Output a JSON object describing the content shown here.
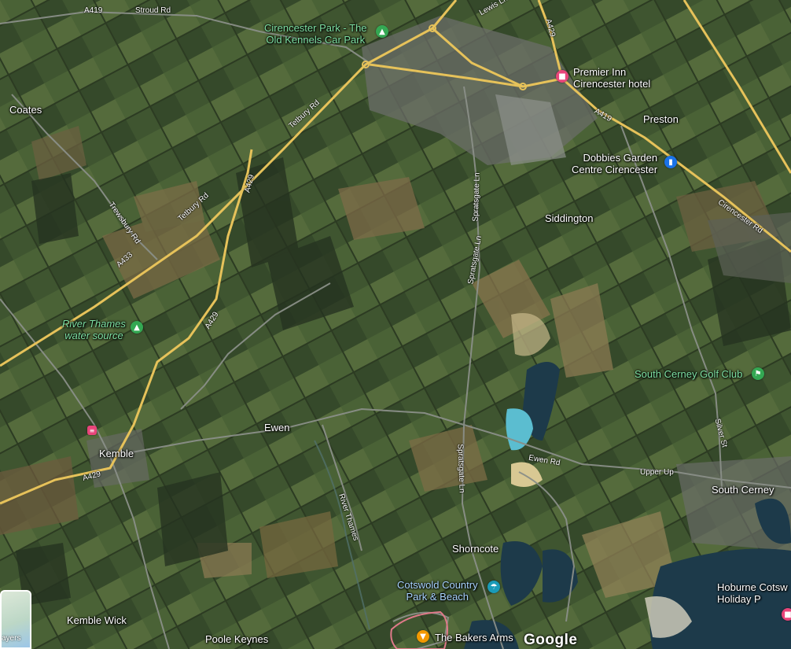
{
  "map": {
    "type": "satellite",
    "branding": "Google",
    "layers_label": "ayers"
  },
  "places": {
    "coates": "Coates",
    "siddington": "Siddington",
    "preston": "Preston",
    "ewen": "Ewen",
    "kemble": "Kemble",
    "south_cerney": "South Cerney",
    "shorncote": "Shorncote",
    "kemble_wick": "Kemble Wick",
    "poole_keynes": "Poole Keynes"
  },
  "pois": {
    "cirencester_park": "Cirencester Park - The Old Kennels Car Park",
    "cirencester_park_line1": "Cirencester Park - The",
    "cirencester_park_line2": "Old Kennels Car Park",
    "premier_inn_line1": "Premier Inn",
    "premier_inn_line2": "Cirencester hotel",
    "dobbies_line1": "Dobbies Garden",
    "dobbies_line2": "Centre Cirencester",
    "river_thames_source_line1": "River Thames",
    "river_thames_source_line2": "water source",
    "golf_club": "South Cerney Golf Club",
    "cotswold_park_line1": "Cotswold Country",
    "cotswold_park_line2": "Park & Beach",
    "hoburne_line1": "Hoburne Cotsw",
    "hoburne_line2": "Holiday P",
    "bakers_arms": "The Bakers Arms"
  },
  "roads": {
    "a419_top": "A419",
    "stroud_rd": "Stroud Rd",
    "lewis_ln": "Lewis Ln",
    "a429_top": "A429",
    "tetbury_rd_1": "Tetbury Rd",
    "tetbury_rd_2": "Tetbury Rd",
    "a429_mid": "A429",
    "trewsbury_rd": "Trewsbury Rd",
    "a433": "A433",
    "a429_low": "A429",
    "a429_kemble": "A429",
    "a419_right": "A419",
    "cirencester_rd": "Cirencester Rd",
    "spratsgate_ln_1": "Spratsgate Ln",
    "spratsgate_ln_2": "Spratsgate Ln",
    "river_thames": "River Thames",
    "ewen_rd": "Ewen Rd",
    "upper_up": "Upper Up",
    "silver_st": "Silver St"
  },
  "colors": {
    "main_road": "#e6c25a",
    "minor_road": "#8a8f88",
    "poi_green": "#34a853",
    "poi_blue": "#1a73e8",
    "poi_pink": "#e8457a",
    "poi_orange": "#f29900",
    "lake": "#1d3a4a",
    "lake_turquoise": "#5bbdd0"
  },
  "icons": {
    "park": "tree-icon",
    "hotel": "bed-icon",
    "shop": "shopping-bag-icon",
    "golf": "golf-icon",
    "beach": "beach-icon",
    "pub": "drink-icon",
    "holiday": "bed-icon",
    "rail": "railway-icon"
  }
}
